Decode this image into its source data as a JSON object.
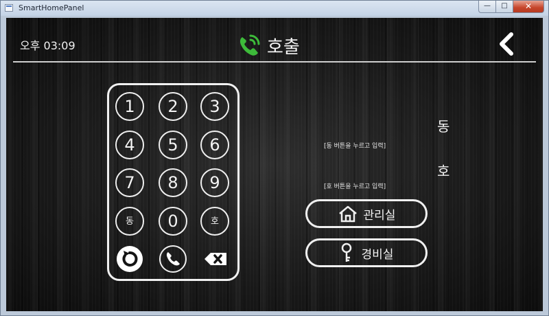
{
  "window": {
    "title": "SmartHomePanel"
  },
  "header": {
    "time": "오후 03:09",
    "title": "호출"
  },
  "keypad": {
    "digits": [
      "1",
      "2",
      "3",
      "4",
      "5",
      "6",
      "7",
      "8",
      "9"
    ],
    "dong_key": "동",
    "zero_key": "0",
    "ho_key": "호"
  },
  "fields": {
    "dong_label": "동",
    "dong_hint": "[동 버튼을 누르고 입력]",
    "ho_label": "호",
    "ho_hint": "[호 버튼을 누르고 입력]"
  },
  "buttons": {
    "office": "관리실",
    "security": "경비실"
  },
  "colors": {
    "accent_green": "#3dba3a",
    "background": "#151515",
    "foreground": "#f2f2f2"
  }
}
